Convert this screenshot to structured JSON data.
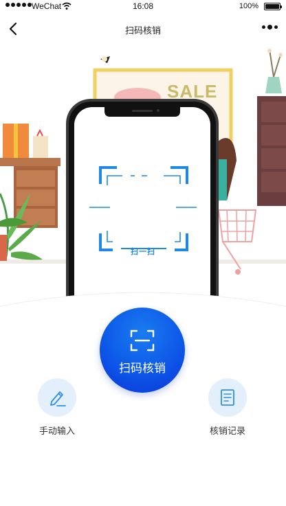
{
  "status_bar": {
    "carrier": "WeChat",
    "time": "16:08",
    "battery": "100%"
  },
  "nav": {
    "title": "扫码核销"
  },
  "hero": {
    "sale_sign": "SALE",
    "scan_hint": "扫一扫"
  },
  "actions": {
    "scan_label": "扫码核销",
    "manual_label": "手动输入",
    "records_label": "核销记录"
  },
  "colors": {
    "accent": "#0d57e8",
    "scan_frame": "#1e88e5",
    "icon_bg": "#e3f0fc"
  },
  "icons": [
    "back-icon",
    "more-icon",
    "wifi-icon",
    "battery-icon",
    "scan-icon",
    "pencil-icon",
    "document-icon"
  ]
}
